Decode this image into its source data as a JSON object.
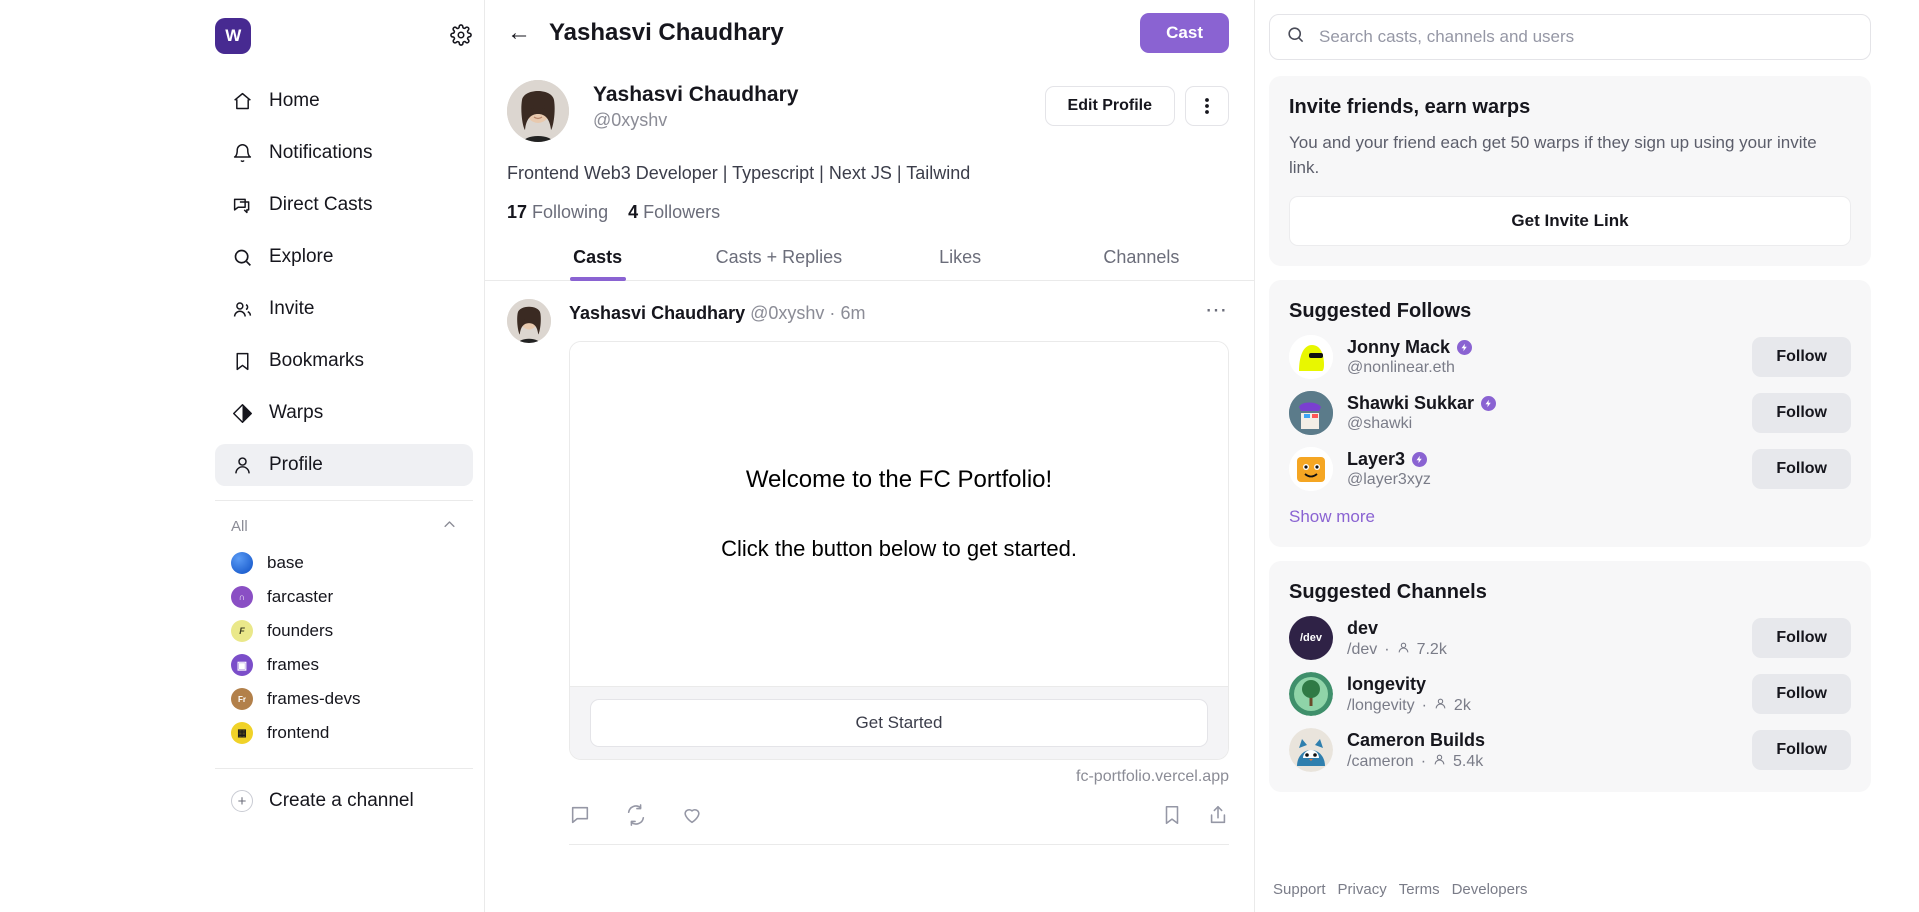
{
  "brand": {
    "logo_letter": "W",
    "accent": "#8a63d2",
    "logo_bg": "#472a91"
  },
  "sidebar": {
    "nav": [
      {
        "label": "Home",
        "icon": "home-icon",
        "active": false
      },
      {
        "label": "Notifications",
        "icon": "bell-icon",
        "active": false
      },
      {
        "label": "Direct Casts",
        "icon": "chat-icon",
        "active": false
      },
      {
        "label": "Explore",
        "icon": "search-icon",
        "active": false
      },
      {
        "label": "Invite",
        "icon": "users-icon",
        "active": false
      },
      {
        "label": "Bookmarks",
        "icon": "bookmark-icon",
        "active": false
      },
      {
        "label": "Warps",
        "icon": "warp-diamond-icon",
        "active": false
      },
      {
        "label": "Profile",
        "icon": "person-icon",
        "active": true
      }
    ],
    "group_label": "All",
    "channels": [
      {
        "label": "base",
        "color": "#1555d6"
      },
      {
        "label": "farcaster",
        "color": "#8a4fc4"
      },
      {
        "label": "founders",
        "color": "#eae88a"
      },
      {
        "label": "frames",
        "color": "#7b4ec9"
      },
      {
        "label": "frames-devs",
        "color": "#b2804a"
      },
      {
        "label": "frontend",
        "color": "#f0d228"
      }
    ],
    "create_channel": "Create a channel"
  },
  "header": {
    "title": "Yashasvi Chaudhary",
    "cast_button": "Cast",
    "back_icon": "arrow-left-icon"
  },
  "profile": {
    "display_name": "Yashasvi Chaudhary",
    "handle": "@0xyshv",
    "bio": "Frontend Web3 Developer | Typescript | Next JS | Tailwind",
    "following_count": "17",
    "following_label": "Following",
    "followers_count": "4",
    "followers_label": "Followers",
    "edit_button": "Edit Profile",
    "more_button": "more-options"
  },
  "tabs": [
    {
      "label": "Casts",
      "active": true
    },
    {
      "label": "Casts + Replies",
      "active": false
    },
    {
      "label": "Likes",
      "active": false
    },
    {
      "label": "Channels",
      "active": false
    }
  ],
  "cast": {
    "author_name": "Yashasvi Chaudhary",
    "author_handle": "@0xyshv",
    "separator": "·",
    "timestamp": "6m",
    "frame": {
      "line1": "Welcome to the FC Portfolio!",
      "line2": "Click the button below to get started.",
      "button": "Get Started",
      "url": "fc-portfolio.vercel.app"
    },
    "actions": [
      {
        "name": "reply-icon"
      },
      {
        "name": "recast-icon"
      },
      {
        "name": "like-icon"
      },
      {
        "name": "bookmark-icon"
      },
      {
        "name": "share-icon"
      }
    ]
  },
  "search": {
    "placeholder": "Search casts, channels and users",
    "value": ""
  },
  "invite_card": {
    "title": "Invite friends, earn warps",
    "description": "You and your friend each get 50 warps if they sign up using your invite link.",
    "button": "Get Invite Link"
  },
  "suggested_follows": {
    "title": "Suggested Follows",
    "show_more": "Show more",
    "follow_label": "Follow",
    "items": [
      {
        "name": "Jonny Mack",
        "handle": "@nonlinear.eth",
        "verified": true,
        "av_bg": "#ffffff",
        "av_fg": "#e8f700",
        "glyph": "◕"
      },
      {
        "name": "Shawki Sukkar",
        "handle": "@shawki",
        "verified": true,
        "av_bg": "#5b7b8a",
        "av_fg": "#7a3fd0",
        "glyph": "◔"
      },
      {
        "name": "Layer3",
        "handle": "@layer3xyz",
        "verified": true,
        "av_bg": "#ffffff",
        "av_fg": "#f5a623",
        "glyph": "■"
      }
    ]
  },
  "suggested_channels": {
    "title": "Suggested Channels",
    "follow_label": "Follow",
    "separator": "·",
    "items": [
      {
        "name": "dev",
        "slug": "/dev",
        "members": "7.2k",
        "av_bg": "#2f2246",
        "av_text": "/dev"
      },
      {
        "name": "longevity",
        "slug": "/longevity",
        "members": "2k",
        "av_bg": "#2f6b3a",
        "av_text": "☘"
      },
      {
        "name": "Cameron Builds",
        "slug": "/cameron",
        "members": "5.4k",
        "av_bg": "#2f7fae",
        "av_text": "◑"
      }
    ]
  },
  "footer": {
    "links": [
      "Support",
      "Privacy",
      "Terms",
      "Developers"
    ]
  }
}
